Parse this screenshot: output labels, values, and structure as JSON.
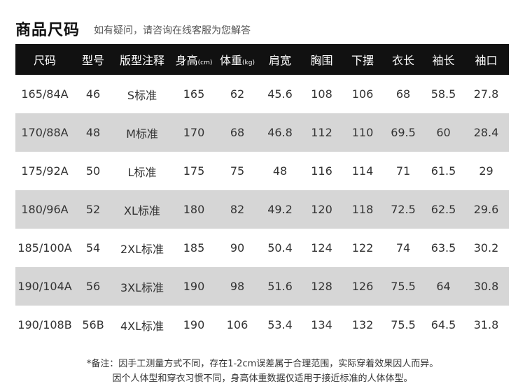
{
  "header": {
    "title": "商品尺码",
    "subtitle": "如有疑问，请咨询在线客服为您解答"
  },
  "table": {
    "columns": [
      {
        "label": "尺码",
        "unit": ""
      },
      {
        "label": "型号",
        "unit": ""
      },
      {
        "label": "版型注释",
        "unit": ""
      },
      {
        "label": "身高",
        "unit": "(cm)"
      },
      {
        "label": "体重",
        "unit": "(kg)"
      },
      {
        "label": "肩宽",
        "unit": ""
      },
      {
        "label": "胸围",
        "unit": ""
      },
      {
        "label": "下摆",
        "unit": ""
      },
      {
        "label": "衣长",
        "unit": ""
      },
      {
        "label": "袖长",
        "unit": ""
      },
      {
        "label": "袖口",
        "unit": ""
      }
    ],
    "rows": [
      [
        "165/84A",
        "46",
        "S标准",
        "165",
        "62",
        "45.6",
        "108",
        "106",
        "68",
        "58.5",
        "27.8"
      ],
      [
        "170/88A",
        "48",
        "M标准",
        "170",
        "68",
        "46.8",
        "112",
        "110",
        "69.5",
        "60",
        "28.4"
      ],
      [
        "175/92A",
        "50",
        "L标准",
        "175",
        "75",
        "48",
        "116",
        "114",
        "71",
        "61.5",
        "29"
      ],
      [
        "180/96A",
        "52",
        "XL标准",
        "180",
        "82",
        "49.2",
        "120",
        "118",
        "72.5",
        "62.5",
        "29.6"
      ],
      [
        "185/100A",
        "54",
        "2XL标准",
        "185",
        "90",
        "50.4",
        "124",
        "122",
        "74",
        "63.5",
        "30.2"
      ],
      [
        "190/104A",
        "56",
        "3XL标准",
        "190",
        "98",
        "51.6",
        "128",
        "126",
        "75.5",
        "64",
        "30.8"
      ],
      [
        "190/108B",
        "56B",
        "4XL标准",
        "190",
        "106",
        "53.4",
        "134",
        "132",
        "75.5",
        "64.5",
        "31.8"
      ]
    ]
  },
  "notes": {
    "line1": "*备注：因手工测量方式不同，存在1-2cm误差属于合理范围，实际穿着效果因人而异。",
    "line2": "因个人体型和穿衣习惯不同，身高体重数据仅适用于接近标准的人体体型。"
  }
}
